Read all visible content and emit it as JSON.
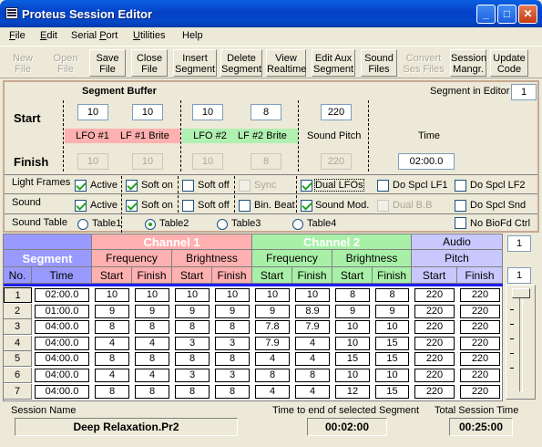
{
  "window": {
    "title": "Proteus Session Editor"
  },
  "menu": [
    "File",
    "Edit",
    "Serial Port",
    "Utilities",
    "Help"
  ],
  "menu_underline": [
    "F",
    "E",
    "P",
    "U",
    ""
  ],
  "toolbar": [
    {
      "line1": "New",
      "line2": "File",
      "enabled": false
    },
    {
      "line1": "Open",
      "line2": "File",
      "enabled": false
    },
    {
      "line1": "Save",
      "line2": "File",
      "enabled": true
    },
    {
      "line1": "Close",
      "line2": "File",
      "enabled": true
    },
    {
      "line1": "Insert",
      "line2": "Segment",
      "enabled": true
    },
    {
      "line1": "Delete",
      "line2": "Segment",
      "enabled": true
    },
    {
      "line1": "View",
      "line2": "Realtime",
      "enabled": true
    },
    {
      "line1": "Edit Aux",
      "line2": "Segment",
      "enabled": true
    },
    {
      "line1": "Sound",
      "line2": "Files",
      "enabled": true
    },
    {
      "line1": "Convert",
      "line2": "Ses Files",
      "enabled": false
    },
    {
      "line1": "Session",
      "line2": "Mangr.",
      "enabled": true
    },
    {
      "line1": "Update",
      "line2": "Code",
      "enabled": true
    }
  ],
  "buffer": {
    "title": "Segment Buffer",
    "seg_in_editor_label": "Segment in Editor",
    "seg_in_editor": "1",
    "start_label": "Start",
    "finish_label": "Finish",
    "start": [
      "10",
      "10",
      "10",
      "8",
      "220"
    ],
    "finish": [
      "10",
      "10",
      "10",
      "8",
      "220"
    ],
    "labels": [
      "LFO #1",
      "LF #1 Brite",
      "LFO #2",
      "LF #2 Brite",
      "Sound Pitch",
      "Time"
    ],
    "time": "02:00.0"
  },
  "options": {
    "light_frames_label": "Light Frames",
    "sound_label": "Sound",
    "sound_table_label": "Sound Table",
    "lf_active": "Active",
    "lf_soft_on": "Soft on",
    "lf_soft_off": "Soft off",
    "lf_sync": "Sync",
    "lf_dual": "Dual LFOs",
    "lf_spcl1": "Do Spcl LF1",
    "lf_spcl2": "Do Spcl LF2",
    "s_active": "Active",
    "s_soft_on": "Soft on",
    "s_soft_off": "Soft off",
    "s_binbeat": "Bin. Beat",
    "s_soundmod": "Sound Mod.",
    "s_dualbb": "Dual B.B",
    "s_spclsnd": "Do Spcl Snd",
    "tables": [
      "Table1",
      "Table2",
      "Table3",
      "Table4"
    ],
    "selected_table": "Table2",
    "no_biofd": "No BioFd Ctrl"
  },
  "grid": {
    "headers": {
      "segment": "Segment",
      "channel1": "Channel 1",
      "channel2": "Channel 2",
      "audio": "Audio",
      "pitch": "Pitch",
      "frequency": "Frequency",
      "brightness": "Brightness",
      "no": "No.",
      "time": "Time",
      "start": "Start",
      "finish": "Finish"
    },
    "colors": {
      "segment": "#9999ff",
      "channel1": "#ffb0b0",
      "channel2": "#a8f0a8",
      "audio": "#c8c8ff"
    },
    "spin_top": "1",
    "spin_bottom": "1",
    "rows": [
      [
        "1",
        "02:00.0",
        "10",
        "10",
        "10",
        "10",
        "10",
        "10",
        "8",
        "8",
        "220",
        "220"
      ],
      [
        "2",
        "01:00.0",
        "9",
        "9",
        "9",
        "9",
        "9",
        "8.9",
        "9",
        "9",
        "220",
        "220"
      ],
      [
        "3",
        "04:00.0",
        "8",
        "8",
        "8",
        "8",
        "7.8",
        "7.9",
        "10",
        "10",
        "220",
        "220"
      ],
      [
        "4",
        "04:00.0",
        "4",
        "4",
        "3",
        "3",
        "7.9",
        "4",
        "10",
        "15",
        "220",
        "220"
      ],
      [
        "5",
        "04:00.0",
        "8",
        "8",
        "8",
        "8",
        "4",
        "4",
        "15",
        "15",
        "220",
        "220"
      ],
      [
        "6",
        "04:00.0",
        "4",
        "4",
        "3",
        "3",
        "8",
        "8",
        "10",
        "10",
        "220",
        "220"
      ],
      [
        "7",
        "04:00.0",
        "8",
        "8",
        "8",
        "8",
        "4",
        "4",
        "12",
        "15",
        "220",
        "220"
      ]
    ]
  },
  "footer": {
    "session_name_label": "Session Name",
    "session_name": "Deep Relaxation.Pr2",
    "time_to_end_label": "Time to end of selected Segment",
    "time_to_end": "00:02:00",
    "total_label": "Total Session Time",
    "total": "00:25:00"
  }
}
